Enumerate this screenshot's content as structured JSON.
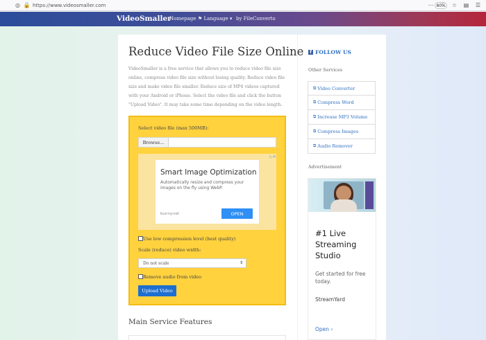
{
  "browser": {
    "url": "https://www.videosmaller.com",
    "zoom": "80%"
  },
  "navbar": {
    "brand": "VideoSmaller",
    "links": [
      "Homepage",
      "Language",
      "by FileConverto"
    ]
  },
  "main": {
    "title": "Reduce Video File Size Online",
    "intro": "VideoSmaller is a free service that allows you to reduce video file size online, compress video file size without losing quality. Reduce video file size and make video file smaller. Reduce size of MP4 videos captured with your Android or iPhone. Select the video file and click the button \"Upload Video\". It may take some time depending on the video length.",
    "upload": {
      "select_label": "Select video file (max 500MB):",
      "browse_label": "Browse...",
      "low_compression_label": "Use low compression level (best quality)",
      "scale_label": "Scale (reduce) video width:",
      "scale_value": "Do not scale",
      "remove_audio_label": "Remove audio from video",
      "upload_button": "Upload Video"
    },
    "ad": {
      "title": "Smart Image Optimization",
      "desc": "Automatically resize and compress your images on the fly using WebP.",
      "source": "bunny.net",
      "open": "OPEN"
    },
    "features_title": "Main Service Features"
  },
  "sidebar": {
    "follow": "FOLLOW US",
    "other_title": "Other Services",
    "services": [
      "Video Converter",
      "Compress Word",
      "Increase MP3 Volume",
      "Compress Images",
      "Audio Remover"
    ],
    "advert_title": "Advertisement",
    "ad": {
      "headline": "#1 Live Streaming Studio",
      "sub": "Get started for free today.",
      "brand": "StreamYard",
      "open": "Open"
    }
  }
}
